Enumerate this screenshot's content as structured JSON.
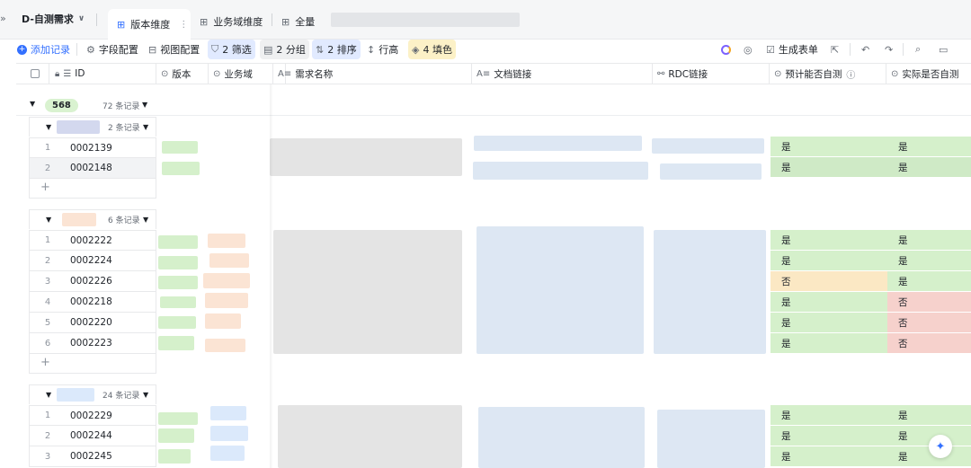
{
  "tabbar": {
    "sidebar_toggle": "»",
    "view_dropdown": "D-自测需求",
    "tabs": [
      {
        "label": "版本维度",
        "active": true
      },
      {
        "label": "业务域维度",
        "active": false
      },
      {
        "label": "全量",
        "active": false
      }
    ]
  },
  "toolbar": {
    "add_record": "添加记录",
    "field_config": "字段配置",
    "view_config": "视图配置",
    "filter": "2 筛选",
    "group": "2 分组",
    "sort": "2 排序",
    "row_height": "行高",
    "fill": "4 填色",
    "generate_form": "生成表单"
  },
  "columns": {
    "id": "ID",
    "version": "版本",
    "domain": "业务域",
    "req_name": "需求名称",
    "doc_link": "文档链接",
    "rdc_link": "RDC链接",
    "expected_self_test": "预计能否自测",
    "actual_self_test": "实际是否自测"
  },
  "groups": [
    {
      "label": "568",
      "count": "72 条记录",
      "subgroups": [
        {
          "count": "2 条记录",
          "rows": [
            {
              "n": "1",
              "id": "0002139",
              "expected": "是",
              "actual": "是"
            },
            {
              "n": "2",
              "id": "0002148",
              "expected": "是",
              "actual": "是"
            }
          ]
        },
        {
          "count": "6 条记录",
          "rows": [
            {
              "n": "1",
              "id": "0002222",
              "expected": "是",
              "actual": "是"
            },
            {
              "n": "2",
              "id": "0002224",
              "expected": "是",
              "actual": "是"
            },
            {
              "n": "3",
              "id": "0002226",
              "expected": "否",
              "actual": "是"
            },
            {
              "n": "4",
              "id": "0002218",
              "expected": "是",
              "actual": "否"
            },
            {
              "n": "5",
              "id": "0002220",
              "expected": "是",
              "actual": "否"
            },
            {
              "n": "6",
              "id": "0002223",
              "expected": "是",
              "actual": "否"
            }
          ]
        },
        {
          "count": "24 条记录",
          "rows": [
            {
              "n": "1",
              "id": "0002229",
              "expected": "是",
              "actual": "是"
            },
            {
              "n": "2",
              "id": "0002244",
              "expected": "是",
              "actual": "是"
            },
            {
              "n": "3",
              "id": "0002245",
              "expected": "是",
              "actual": "是"
            }
          ]
        }
      ]
    }
  ],
  "add_row_symbol": "+",
  "colors": {
    "yes": "#d5f0cb",
    "no_expected": "#fbe8c4",
    "no_actual": "#f6d1cc",
    "accent": "#3370ff"
  }
}
